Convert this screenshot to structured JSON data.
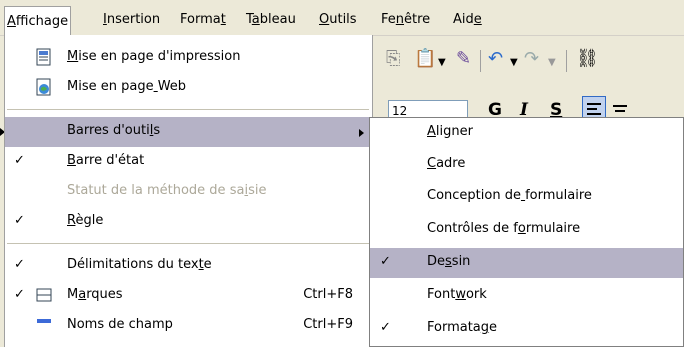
{
  "menubar": [
    {
      "label": "Affichage",
      "u": 0,
      "active": true
    },
    {
      "label": "Insertion",
      "u": 0
    },
    {
      "label": "Format",
      "u": 5
    },
    {
      "label": "Tableau",
      "u": 1
    },
    {
      "label": "Outils",
      "u": 0
    },
    {
      "label": "Fenêtre",
      "u": 2
    },
    {
      "label": "Aide",
      "u": 3
    }
  ],
  "toolbar": {
    "font_size_value": "12",
    "bold_label": "G",
    "italic_label": "I",
    "underline_label": "S"
  },
  "view_menu": [
    {
      "type": "item",
      "label": "Mise en page d'impression",
      "u": 0,
      "icon": "print-layout-icon"
    },
    {
      "type": "item",
      "label": "Mise en page Web",
      "u": 12,
      "icon": "web-layout-icon"
    },
    {
      "type": "sep"
    },
    {
      "type": "item",
      "label": "Barres d'outils",
      "u": 13,
      "submenu": true,
      "highlighted": true
    },
    {
      "type": "item",
      "label": "Barre d'état",
      "u": 0,
      "checked": true
    },
    {
      "type": "item",
      "label": "Statut de la méthode de saisie",
      "u": 26,
      "disabled": true
    },
    {
      "type": "item",
      "label": "Règle",
      "u": 0,
      "checked": true
    },
    {
      "type": "sep"
    },
    {
      "type": "item",
      "label": "Délimitations du texte",
      "u": 20,
      "checked": true
    },
    {
      "type": "item",
      "label": "Marques",
      "u": 1,
      "checked": true,
      "icon": "fields-marks-icon",
      "shortcut": "Ctrl+F8"
    },
    {
      "type": "item",
      "label": "Noms de champ",
      "u": -1,
      "icon": "field-names-icon",
      "shortcut": "Ctrl+F9"
    }
  ],
  "toolbars_submenu": [
    {
      "label": "Aligner",
      "u": 0
    },
    {
      "label": "Cadre",
      "u": 0
    },
    {
      "label": "Conception de formulaire",
      "u": 13
    },
    {
      "label": "Contrôles de formulaire",
      "u": 14
    },
    {
      "label": "Dessin",
      "u": 2,
      "checked": true,
      "highlighted": true
    },
    {
      "label": "Fontwork",
      "u": 4
    },
    {
      "label": "Formatage",
      "u": 7,
      "checked": true
    }
  ],
  "colors": {
    "menubar_bg": "#ece9d8",
    "highlight_bg": "#b5b2c6",
    "disabled_text": "#aca899"
  },
  "check_glyph": "✓"
}
